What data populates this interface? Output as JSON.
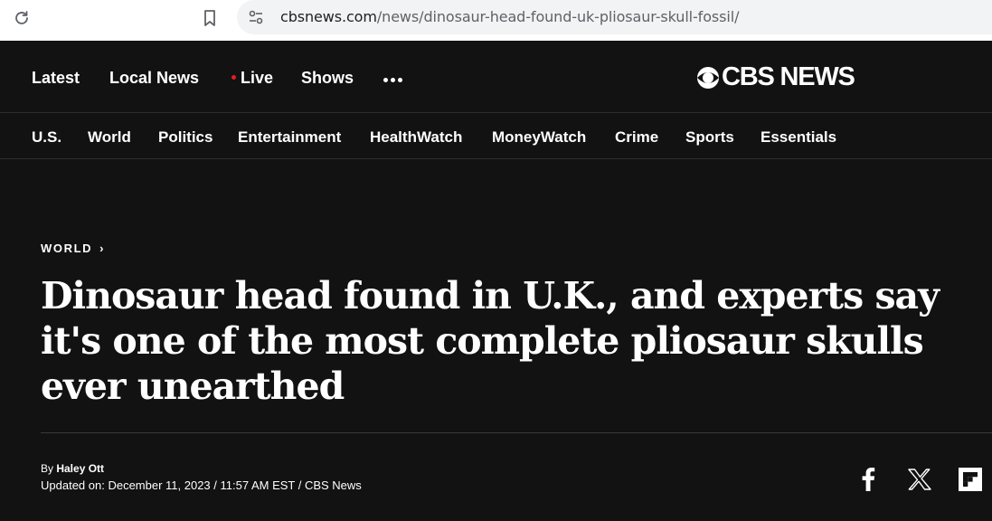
{
  "browser": {
    "url_domain": "cbsnews.com",
    "url_path": "/news/dinosaur-head-found-uk-pliosaur-skull-fossil/"
  },
  "top_nav": {
    "items": [
      "Latest",
      "Local News",
      "Live",
      "Shows"
    ],
    "logo_text": "CBS NEWS",
    "live_color": "#e0201b"
  },
  "sections": [
    "U.S.",
    "World",
    "Politics",
    "Entertainment",
    "HealthWatch",
    "MoneyWatch",
    "Crime",
    "Sports",
    "Essentials"
  ],
  "article": {
    "category": "WORLD",
    "headline": "Dinosaur head found in U.K., and experts say it's one of the most complete pliosaur skulls ever unearthed",
    "byline_prefix": "By ",
    "author": "Haley Ott",
    "updated": "Updated on: December 11, 2023 / 11:57 AM EST / CBS News"
  },
  "share_icons": [
    "facebook-icon",
    "x-icon",
    "flipboard-icon"
  ],
  "colors": {
    "background": "#121212",
    "text": "#ffffff",
    "live_dot": "#e0201b"
  }
}
